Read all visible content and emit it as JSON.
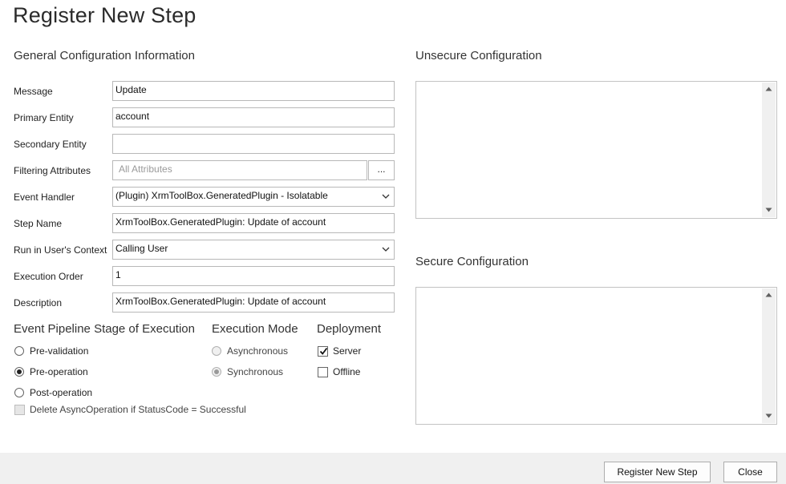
{
  "title": "Register New Step",
  "general": {
    "section_title": "General Configuration Information",
    "message": {
      "label": "Message",
      "value": "Update"
    },
    "primary_entity": {
      "label": "Primary Entity",
      "value": "account"
    },
    "secondary_entity": {
      "label": "Secondary Entity",
      "value": ""
    },
    "filtering_attributes": {
      "label": "Filtering Attributes",
      "placeholder": "All Attributes",
      "button": "..."
    },
    "event_handler": {
      "label": "Event Handler",
      "value": "(Plugin) XrmToolBox.GeneratedPlugin - Isolatable"
    },
    "step_name": {
      "label": "Step Name",
      "value": "XrmToolBox.GeneratedPlugin: Update of account"
    },
    "run_context": {
      "label": "Run in User's Context",
      "value": "Calling User"
    },
    "execution_order": {
      "label": "Execution Order",
      "value": "1"
    },
    "description": {
      "label": "Description",
      "value": "XrmToolBox.GeneratedPlugin: Update of account"
    }
  },
  "pipeline": {
    "title": "Event Pipeline Stage of Execution",
    "options": [
      {
        "label": "Pre-validation",
        "selected": false
      },
      {
        "label": "Pre-operation",
        "selected": true
      },
      {
        "label": "Post-operation",
        "selected": false
      }
    ],
    "delete_async": {
      "label": "Delete AsyncOperation if StatusCode = Successful",
      "checked": false,
      "enabled": false
    }
  },
  "execution_mode": {
    "title": "Execution Mode",
    "options": [
      {
        "label": "Asynchronous",
        "selected": false,
        "enabled": false
      },
      {
        "label": "Synchronous",
        "selected": true,
        "enabled": false
      }
    ]
  },
  "deployment": {
    "title": "Deployment",
    "options": [
      {
        "label": "Server",
        "checked": true
      },
      {
        "label": "Offline",
        "checked": false
      }
    ]
  },
  "unsecure_config": {
    "title": "Unsecure  Configuration",
    "value": ""
  },
  "secure_config": {
    "title": "Secure  Configuration",
    "value": ""
  },
  "footer": {
    "register_button": "Register New Step",
    "close_button": "Close"
  }
}
